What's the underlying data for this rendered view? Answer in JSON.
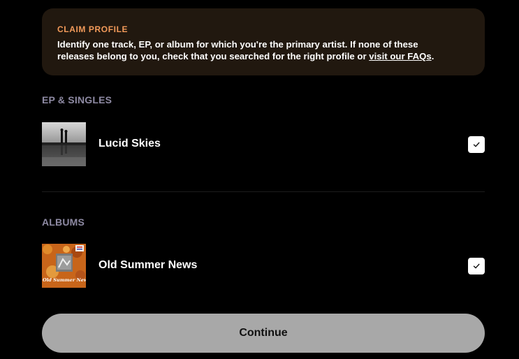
{
  "banner": {
    "title": "CLAIM PROFILE",
    "text_before_link": "Identify one track, EP, or album for which you're the primary artist. If none of these releases belong to you, check that you searched for the right profile or ",
    "link_text": "visit our FAQs",
    "text_after_link": "."
  },
  "sections": {
    "ep_singles": {
      "label": "EP & SINGLES",
      "item": {
        "title": "Lucid Skies",
        "checked": true
      }
    },
    "albums": {
      "label": "ALBUMS",
      "item": {
        "title": "Old Summer News",
        "checked": true,
        "art_text": "Old Summer News"
      }
    }
  },
  "continue_label": "Continue",
  "colors": {
    "background": "#000000",
    "banner_bg": "#21180f",
    "banner_title": "#f29a5a",
    "section_label": "#8e8aa3",
    "button_bg": "#a8a8a8"
  },
  "icons": {
    "checkbox": "checkmark-icon"
  }
}
